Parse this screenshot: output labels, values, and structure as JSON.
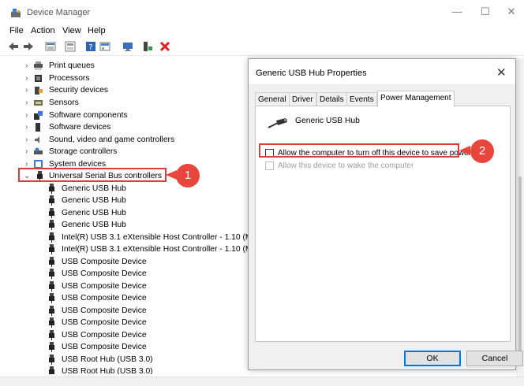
{
  "window": {
    "title": "Device Manager",
    "controls": {
      "minimize": "—",
      "maximize": "☐",
      "close": "✕"
    }
  },
  "menu": [
    "File",
    "Action",
    "View",
    "Help"
  ],
  "toolbar_icons": [
    "back-icon",
    "forward-icon",
    "properties-grid-icon",
    "view-icon",
    "help-icon",
    "update-driver-icon",
    "scan-hardware-icon",
    "enable-device-icon",
    "uninstall-x-icon"
  ],
  "tree": {
    "categories": [
      {
        "label": "Print queues",
        "expanded": false
      },
      {
        "label": "Processors",
        "expanded": false
      },
      {
        "label": "Security devices",
        "expanded": false
      },
      {
        "label": "Sensors",
        "expanded": false
      },
      {
        "label": "Software components",
        "expanded": false
      },
      {
        "label": "Software devices",
        "expanded": false
      },
      {
        "label": "Sound, video and game controllers",
        "expanded": false
      },
      {
        "label": "Storage controllers",
        "expanded": false
      },
      {
        "label": "System devices",
        "expanded": false
      },
      {
        "label": "Universal Serial Bus controllers",
        "expanded": true
      }
    ],
    "usb_children": [
      "Generic USB Hub",
      "Generic USB Hub",
      "Generic USB Hub",
      "Generic USB Hub",
      "Intel(R) USB 3.1 eXtensible Host Controller - 1.10 (Mi",
      "Intel(R) USB 3.1 eXtensible Host Controller - 1.10 (Mi",
      "USB Composite Device",
      "USB Composite Device",
      "USB Composite Device",
      "USB Composite Device",
      "USB Composite Device",
      "USB Composite Device",
      "USB Composite Device",
      "USB Composite Device",
      "USB Root Hub (USB 3.0)",
      "USB Root Hub (USB 3.0)"
    ]
  },
  "dialog": {
    "title": "Generic USB Hub Properties",
    "close": "✕",
    "tabs": [
      "General",
      "Driver",
      "Details",
      "Events",
      "Power Management"
    ],
    "active_tab": "Power Management",
    "device_name": "Generic USB Hub",
    "options": [
      {
        "label": "Allow the computer to turn off this device to save power",
        "checked": false,
        "enabled": true
      },
      {
        "label": "Allow this device to wake the computer",
        "checked": false,
        "enabled": false
      }
    ],
    "buttons": {
      "ok": "OK",
      "cancel": "Cancel"
    }
  },
  "callouts": [
    "1",
    "2"
  ],
  "colors": {
    "highlight": "#e03b3b",
    "badge": "#e8453c",
    "accent": "#0078d7"
  }
}
